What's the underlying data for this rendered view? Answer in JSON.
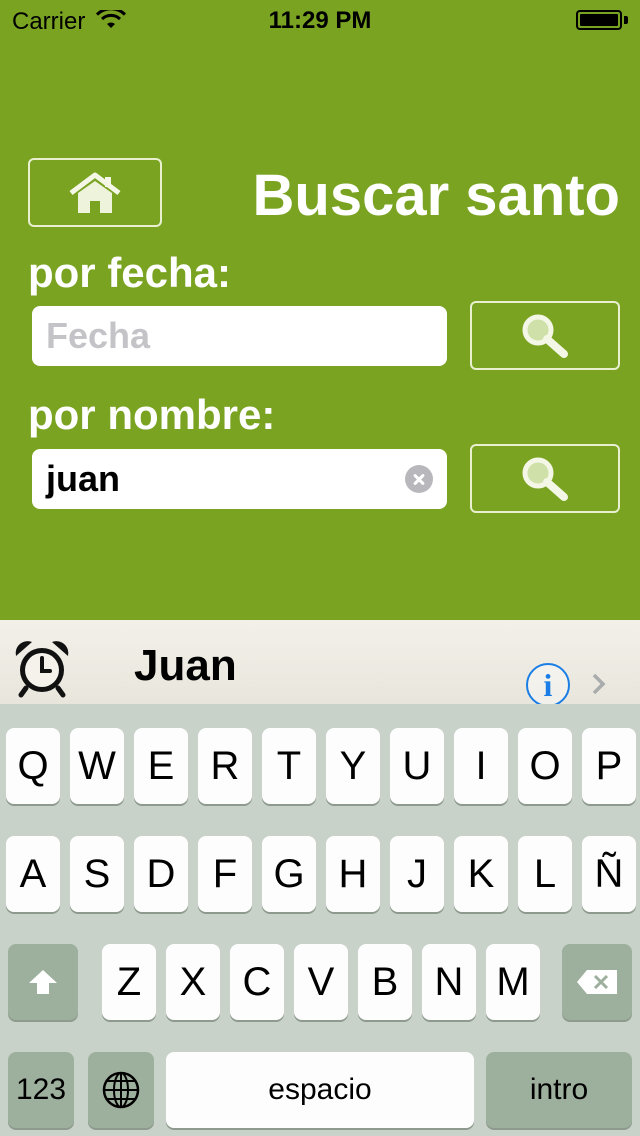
{
  "status_bar": {
    "carrier": "Carrier",
    "time": "11:29 PM",
    "wifi_icon": "wifi-icon",
    "battery_icon": "battery-icon"
  },
  "header": {
    "title": "Buscar santo",
    "home_icon": "home-icon"
  },
  "by_date": {
    "label": "por fecha:",
    "value": "",
    "placeholder": "Fecha",
    "search_icon": "magnifier-icon"
  },
  "by_name": {
    "label": "por nombre:",
    "value": "juan",
    "placeholder": "",
    "search_icon": "magnifier-icon"
  },
  "result": {
    "name": "Juan",
    "info_glyph": "i",
    "alarm_icon": "alarm-clock-icon",
    "chevron_icon": "chevron-right-icon"
  },
  "keyboard": {
    "row1": [
      "Q",
      "W",
      "E",
      "R",
      "T",
      "Y",
      "U",
      "I",
      "O",
      "P"
    ],
    "row2": [
      "A",
      "S",
      "D",
      "F",
      "G",
      "H",
      "J",
      "K",
      "L",
      "Ñ"
    ],
    "row3": [
      "Z",
      "X",
      "C",
      "V",
      "B",
      "N",
      "M"
    ],
    "numbers_label": "123",
    "space_label": "espacio",
    "return_label": "intro"
  },
  "colors": {
    "background": "#7aa321",
    "keyboard_bg": "#c8d2c8",
    "info_blue": "#1a7ee6"
  }
}
